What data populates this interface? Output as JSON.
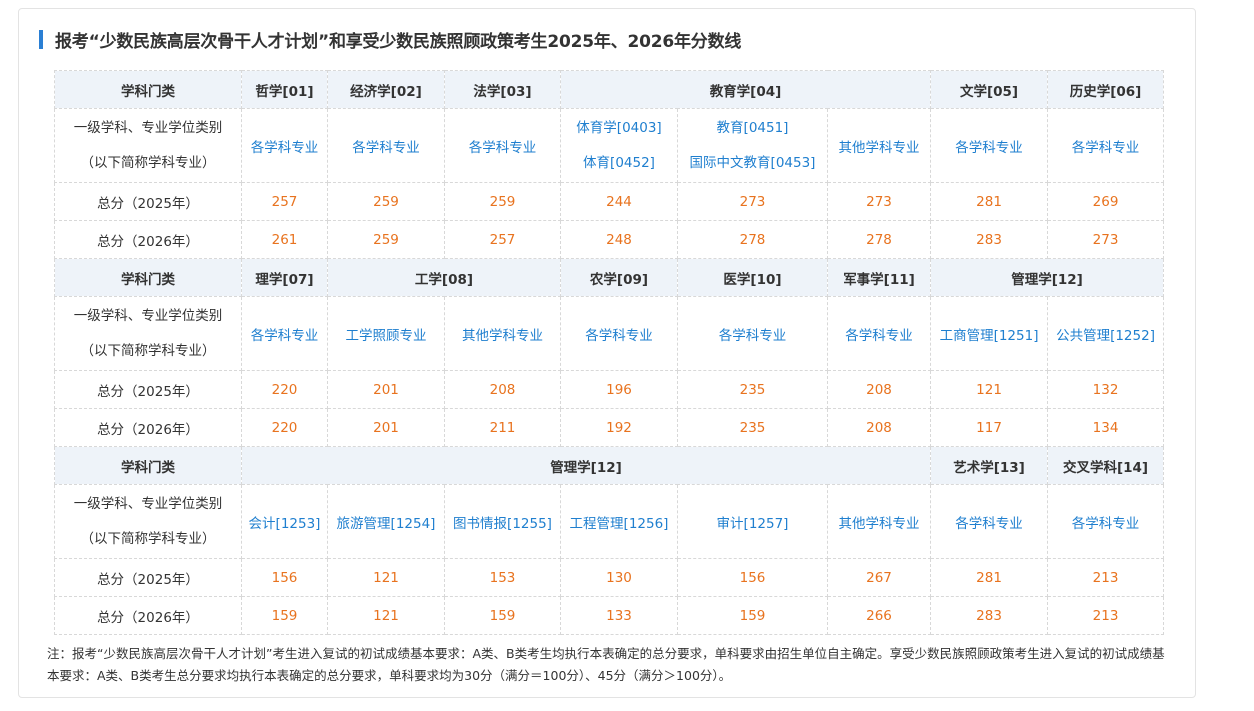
{
  "title": "报考“少数民族高层次骨干人才计划”和享受少数民族照顾政策考生2025年、2026年分数线",
  "row_labels": {
    "category": "学科门类",
    "discipline_1": "一级学科、专业学位类别",
    "discipline_2": "（以下简称学科专业）",
    "total_2025": "总分（2025年）",
    "total_2026": "总分（2026年）"
  },
  "block1": {
    "headers": [
      "哲学[01]",
      "经济学[02]",
      "法学[03]",
      "教育学[04]",
      "文学[05]",
      "历史学[06]"
    ],
    "disciplines": [
      "各学科专业",
      "各学科专业",
      "各学科专业",
      "体育学[0403]",
      "体育[0452]",
      "教育[0451]",
      "国际中文教育[0453]",
      "其他学科专业",
      "各学科专业",
      "各学科专业"
    ],
    "scores_2025": [
      "257",
      "259",
      "259",
      "244",
      "273",
      "273",
      "281",
      "269"
    ],
    "scores_2026": [
      "261",
      "259",
      "257",
      "248",
      "278",
      "278",
      "283",
      "273"
    ]
  },
  "block2": {
    "headers": [
      "理学[07]",
      "工学[08]",
      "农学[09]",
      "医学[10]",
      "军事学[11]",
      "管理学[12]"
    ],
    "disciplines": [
      "各学科专业",
      "工学照顾专业",
      "其他学科专业",
      "各学科专业",
      "各学科专业",
      "各学科专业",
      "工商管理[1251]",
      "公共管理[1252]"
    ],
    "scores_2025": [
      "220",
      "201",
      "208",
      "196",
      "235",
      "208",
      "121",
      "132"
    ],
    "scores_2026": [
      "220",
      "201",
      "211",
      "192",
      "235",
      "208",
      "117",
      "134"
    ]
  },
  "block3": {
    "headers": [
      "管理学[12]",
      "艺术学[13]",
      "交叉学科[14]"
    ],
    "disciplines": [
      "会计[1253]",
      "旅游管理[1254]",
      "图书情报[1255]",
      "工程管理[1256]",
      "审计[1257]",
      "其他学科专业",
      "各学科专业",
      "各学科专业"
    ],
    "scores_2025": [
      "156",
      "121",
      "153",
      "130",
      "156",
      "267",
      "281",
      "213"
    ],
    "scores_2026": [
      "159",
      "121",
      "159",
      "133",
      "159",
      "266",
      "283",
      "213"
    ]
  },
  "note": "注：报考“少数民族高层次骨干人才计划”考生进入复试的初试成绩基本要求：A类、B类考生均执行本表确定的总分要求，单科要求由招生单位自主确定。享受少数民族照顾政策考生进入复试的初试成绩基本要求：A类、B类考生总分要求均执行本表确定的总分要求，单科要求均为30分（满分＝100分）、45分（满分＞100分）。",
  "colors": {
    "accent": "#2a7fd4",
    "link": "#1f7fcf",
    "score": "#e8731f",
    "header_bg": "#eef3f9"
  }
}
